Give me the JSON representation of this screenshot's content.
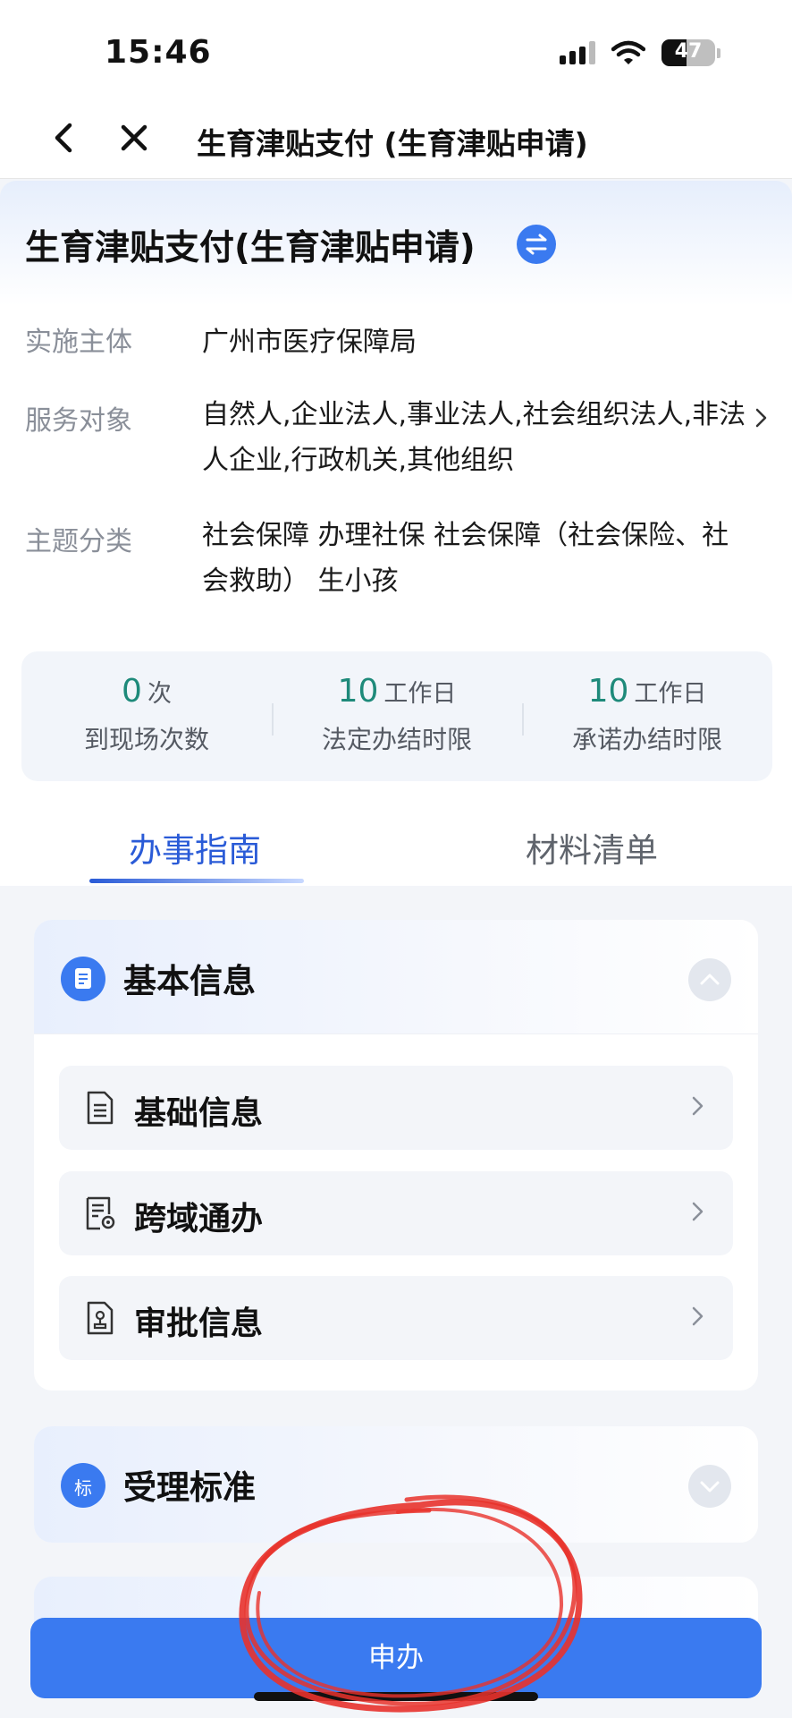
{
  "status_bar": {
    "time": "15:46",
    "battery": "47"
  },
  "nav": {
    "title": "生育津贴支付 (生育津贴申请)"
  },
  "header": {
    "title": "生育津贴支付(生育津贴申请)",
    "rows": [
      {
        "label": "实施主体",
        "value": "广州市医疗保障局"
      },
      {
        "label": "服务对象",
        "value": "自然人,企业法人,事业法人,社会组织法人,非法人企业,行政机关,其他组织"
      },
      {
        "label": "主题分类",
        "value": "社会保障 办理社保 社会保障（社会保险、社会救助） 生小孩"
      }
    ],
    "stats": [
      {
        "value": "0",
        "unit": "次",
        "label": "到现场次数"
      },
      {
        "value": "10",
        "unit": "工作日",
        "label": "法定办结时限"
      },
      {
        "value": "10",
        "unit": "工作日",
        "label": "承诺办结时限"
      }
    ]
  },
  "tabs": [
    {
      "label": "办事指南",
      "active": true
    },
    {
      "label": "材料清单",
      "active": false
    }
  ],
  "sections": {
    "basic": {
      "title": "基本信息",
      "items": [
        {
          "label": "基础信息",
          "icon": "document-icon"
        },
        {
          "label": "跨域通办",
          "icon": "location-document-icon"
        },
        {
          "label": "审批信息",
          "icon": "stamp-document-icon"
        }
      ]
    },
    "accept": {
      "title": "受理标准",
      "icon_text": "标"
    }
  },
  "apply_button": {
    "label": "申办"
  },
  "colors": {
    "accent": "#3a7af0",
    "stat_number": "#1e8a7a",
    "annotation": "#e8322c"
  }
}
